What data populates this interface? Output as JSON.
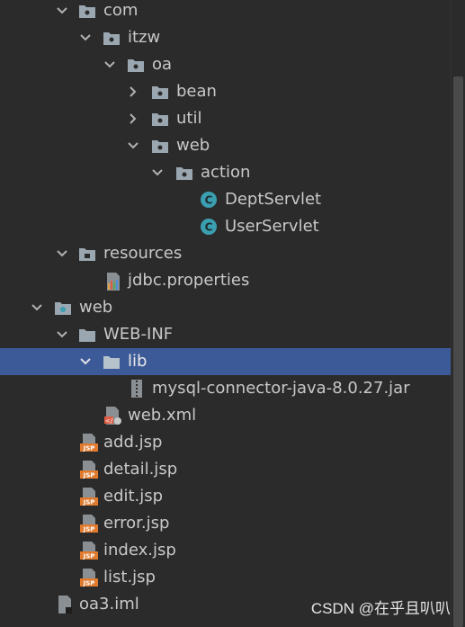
{
  "tree": [
    {
      "label": "com",
      "icon": "package-folder-icon",
      "expanded": true
    },
    {
      "label": "itzw",
      "icon": "package-folder-icon",
      "expanded": true
    },
    {
      "label": "oa",
      "icon": "package-folder-icon",
      "expanded": true
    },
    {
      "label": "bean",
      "icon": "package-folder-icon",
      "expanded": false
    },
    {
      "label": "util",
      "icon": "package-folder-icon",
      "expanded": false
    },
    {
      "label": "web",
      "icon": "package-folder-icon",
      "expanded": true
    },
    {
      "label": "action",
      "icon": "package-folder-icon",
      "expanded": true
    },
    {
      "label": "DeptServlet",
      "icon": "java-class-icon"
    },
    {
      "label": "UserServlet",
      "icon": "java-class-icon"
    },
    {
      "label": "resources",
      "icon": "resources-folder-icon",
      "expanded": true
    },
    {
      "label": "jdbc.properties",
      "icon": "properties-file-icon"
    },
    {
      "label": "web",
      "icon": "web-folder-icon",
      "expanded": true
    },
    {
      "label": "WEB-INF",
      "icon": "folder-icon",
      "expanded": true
    },
    {
      "label": "lib",
      "icon": "folder-icon",
      "expanded": true,
      "selected": true
    },
    {
      "label": "mysql-connector-java-8.0.27.jar",
      "icon": "jar-file-icon"
    },
    {
      "label": "web.xml",
      "icon": "xml-file-icon"
    },
    {
      "label": "add.jsp",
      "icon": "jsp-file-icon"
    },
    {
      "label": "detail.jsp",
      "icon": "jsp-file-icon"
    },
    {
      "label": "edit.jsp",
      "icon": "jsp-file-icon"
    },
    {
      "label": "error.jsp",
      "icon": "jsp-file-icon"
    },
    {
      "label": "index.jsp",
      "icon": "jsp-file-icon"
    },
    {
      "label": "list.jsp",
      "icon": "jsp-file-icon"
    },
    {
      "label": "oa3.iml",
      "icon": "iml-file-icon"
    }
  ],
  "watermark": "CSDN @在乎且叭叭",
  "colors": {
    "background": "#2b2b2b",
    "selection": "#3d5a98",
    "text": "#c8c8c8",
    "chevron": "#afb1b3",
    "folder": "#9aa7b0",
    "java_class": "#3a9fb0",
    "jsp": "#e07a2e"
  }
}
